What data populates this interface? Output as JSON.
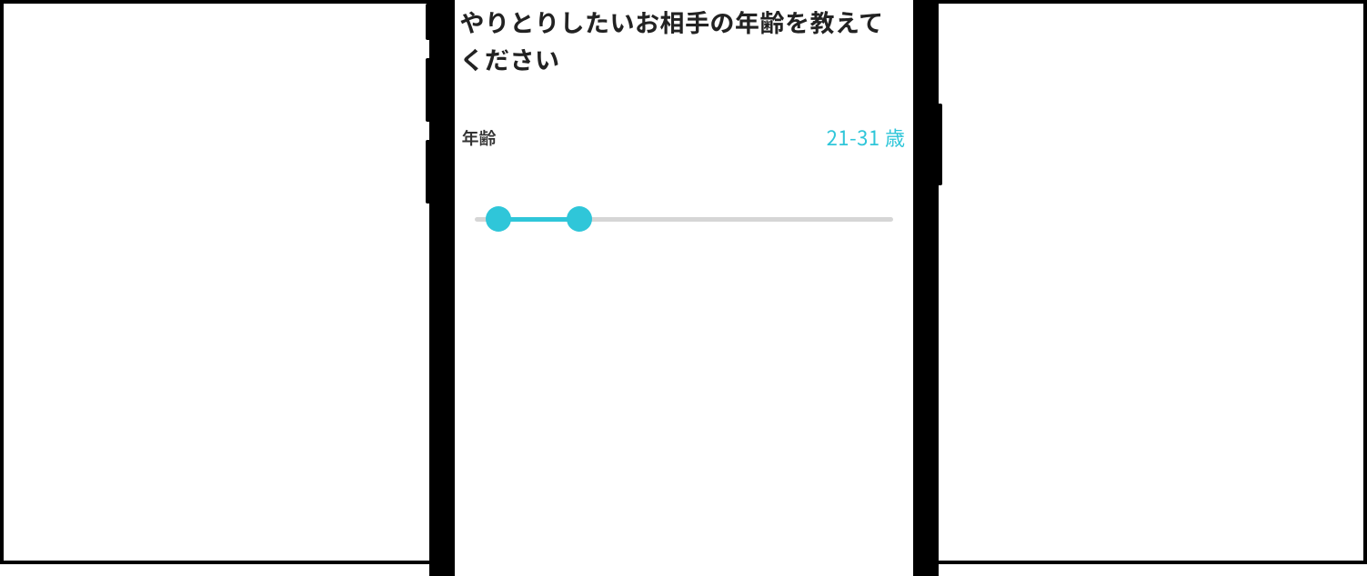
{
  "page": {
    "title": "やりとりしたいお相手の年齢を教えてください"
  },
  "age_slider": {
    "label": "年齢",
    "value_display": "21-31 歳",
    "min": 18,
    "max": 70,
    "low": 21,
    "high": 31,
    "accent_color": "#2fc6d9",
    "track_color": "#d6d6d6"
  }
}
